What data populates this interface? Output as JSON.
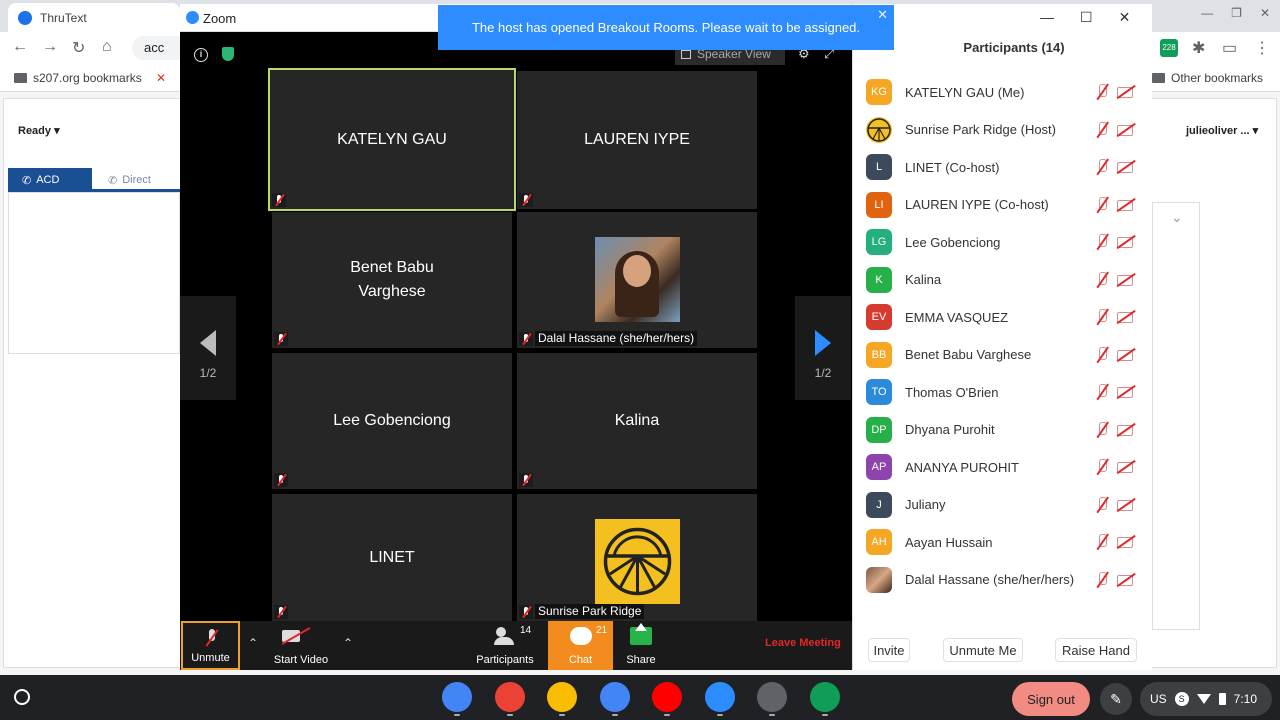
{
  "browser": {
    "tab_title": "ThruText",
    "address_partial": "acc",
    "bookmarks": [
      "s207.org bookmarks",
      "Other bookmarks"
    ],
    "ext_badge": "228"
  },
  "thrutext": {
    "status": "Ready",
    "tabs": [
      "ACD",
      "Direct"
    ],
    "user": "julieoliver ..."
  },
  "zoom": {
    "window_title": "Zoom",
    "breakout_message": "The host has opened Breakout Rooms. Please wait to be assigned.",
    "speaker_view_label": "Speaker View",
    "page_indicator_left": "1/2",
    "page_indicator_right": "1/2",
    "tiles": [
      {
        "name": "KATELYN GAU",
        "kind": "text",
        "active": true
      },
      {
        "name": "LAUREN IYPE",
        "kind": "text"
      },
      {
        "name": "Benet Babu\nVarghese",
        "kind": "text"
      },
      {
        "name": "Dalal Hassane (she/her/hers)",
        "kind": "photo"
      },
      {
        "name": "Lee Gobenciong",
        "kind": "text"
      },
      {
        "name": "Kalina",
        "kind": "text"
      },
      {
        "name": "LINET",
        "kind": "text"
      },
      {
        "name": "Sunrise Park Ridge",
        "kind": "sun"
      }
    ],
    "toolbar": {
      "unmute": "Unmute",
      "start_video": "Start Video",
      "participants": "Participants",
      "participants_count": "14",
      "chat": "Chat",
      "chat_count": "21",
      "share": "Share",
      "leave": "Leave Meeting"
    }
  },
  "participants_panel": {
    "title": "Participants (14)",
    "list": [
      {
        "initials": "KG",
        "name": "KATELYN GAU (Me)",
        "color": "#f5a623"
      },
      {
        "initials": "",
        "name": "Sunrise Park Ridge (Host)",
        "color": "#f4c020",
        "avatar": "sun"
      },
      {
        "initials": "L",
        "name": "LINET (Co-host)",
        "color": "#3d4a5c"
      },
      {
        "initials": "LI",
        "name": "LAUREN IYPE (Co-host)",
        "color": "#e0640f"
      },
      {
        "initials": "LG",
        "name": "Lee Gobenciong",
        "color": "#23b07d"
      },
      {
        "initials": "K",
        "name": "Kalina",
        "color": "#27b04a"
      },
      {
        "initials": "EV",
        "name": "EMMA VASQUEZ",
        "color": "#d63b2f"
      },
      {
        "initials": "BB",
        "name": "Benet Babu Varghese",
        "color": "#f5a623"
      },
      {
        "initials": "TO",
        "name": "Thomas O'Brien",
        "color": "#2d8ad8"
      },
      {
        "initials": "DP",
        "name": "Dhyana Purohit",
        "color": "#27b04a"
      },
      {
        "initials": "AP",
        "name": "ANANYA PUROHIT",
        "color": "#8e44ad"
      },
      {
        "initials": "J",
        "name": "Juliany",
        "color": "#3d4a5c"
      },
      {
        "initials": "AH",
        "name": "Aayan Hussain",
        "color": "#f5a623"
      },
      {
        "initials": "",
        "name": "Dalal Hassane (she/her/hers)",
        "color": "#7a5a46",
        "avatar": "photo"
      }
    ],
    "buttons": {
      "invite": "Invite",
      "unmute_me": "Unmute Me",
      "raise_hand": "Raise Hand"
    }
  },
  "shelf": {
    "sign_out": "Sign out",
    "locale": "US",
    "ime_badge": "S",
    "time": "7:10",
    "apps": [
      {
        "name": "chrome-icon",
        "color": "#4285f4"
      },
      {
        "name": "gmail-icon",
        "color": "#ea4335"
      },
      {
        "name": "drive-icon",
        "color": "#fbbc04"
      },
      {
        "name": "docs-icon",
        "color": "#4285f4"
      },
      {
        "name": "youtube-icon",
        "color": "#ff0000"
      },
      {
        "name": "zoom-icon",
        "color": "#2d8cff"
      },
      {
        "name": "calculator-icon",
        "color": "#5f6368"
      },
      {
        "name": "hangouts-icon",
        "color": "#0f9d58"
      }
    ]
  }
}
